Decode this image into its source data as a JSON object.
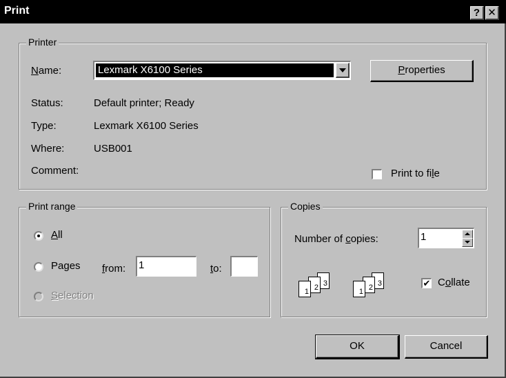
{
  "window": {
    "title": "Print",
    "help_button": "?",
    "close_button": "✕"
  },
  "printer": {
    "group_label": "Printer",
    "name_label": "Name:",
    "name_value": "Lexmark X6100 Series",
    "properties_button": "Properties",
    "status_label": "Status:",
    "status_value": "Default printer; Ready",
    "type_label": "Type:",
    "type_value": "Lexmark X6100 Series",
    "where_label": "Where:",
    "where_value": "USB001",
    "comment_label": "Comment:",
    "print_to_file_label": "Print to file",
    "print_to_file_checked": false
  },
  "print_range": {
    "group_label": "Print range",
    "all_label": "All",
    "pages_label": "Pages",
    "from_label": "from:",
    "from_value": "1",
    "to_label": "to:",
    "to_value": "",
    "selection_label": "Selection",
    "selected": "All"
  },
  "copies": {
    "group_label": "Copies",
    "number_label": "Number of copies:",
    "number_value": "1",
    "collate_label": "Collate",
    "collate_checked": true,
    "collate_icon_pages": [
      "1",
      "2",
      "3"
    ]
  },
  "buttons": {
    "ok": "OK",
    "cancel": "Cancel"
  }
}
